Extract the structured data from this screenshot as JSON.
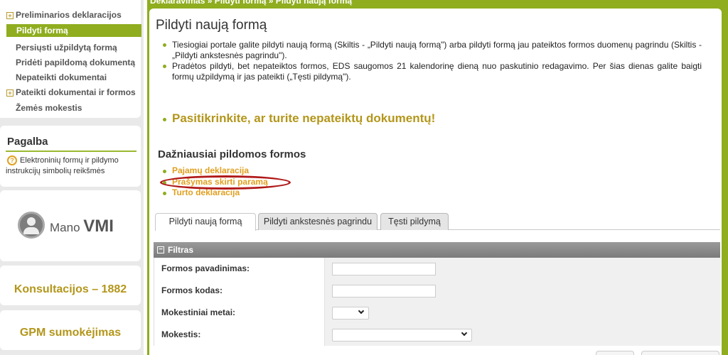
{
  "breadcrumb": "Deklaravimas » Pildyti formą » Pildyti naują formą",
  "sidebar": {
    "items": [
      {
        "label": "Preliminarios deklaracijos",
        "expandable": true
      },
      {
        "label": "Pildyti formą",
        "active": true
      },
      {
        "label": "Persiųsti užpildytą formą"
      },
      {
        "label": "Pridėti papildomą dokumentą"
      },
      {
        "label": "Nepateikti dokumentai"
      },
      {
        "label": "Pateikti dokumentai ir formos",
        "expandable": true
      },
      {
        "label": "Žemės mokestis"
      }
    ],
    "expand_glyph": "+",
    "help": {
      "title": "Pagalba",
      "icon_glyph": "?",
      "link": "Elektroninių formų ir pildymo instrukcijų simbolių reikšmės"
    },
    "logo": {
      "prefix": "Mano",
      "name": "VMI"
    },
    "promos": [
      "Konsultacijos – 1882",
      "GPM sumokėjimas"
    ]
  },
  "main": {
    "title": "Pildyti naują formą",
    "bullets": [
      "Tiesiogiai portale galite pildyti naują formą (Skiltis - „Pildyti naują formą\") arba pildyti formą jau pateiktos formos duomenų pagrindu (Skiltis - „Pildyti ankstesnės pagrindu\").",
      "Pradėtos pildyti, bet nepateiktos formos, EDS saugomos 21 kalendorinę dieną nuo paskutinio redagavimo. Per šias dienas galite baigti formų užpildymą ir jas pateikti („Tęsti pildymą\")."
    ],
    "warning": "Pasitikrinkite, ar turite nepateiktų dokumentų!",
    "frequent_title": "Dažniausiai pildomos formos",
    "frequent_links": [
      "Pajamų deklaracija",
      "Prašymas skirti paramą",
      "Turto deklaracija"
    ],
    "tabs": [
      "Pildyti naują formą",
      "Pildyti ankstesnės pagrindu",
      "Tęsti pildymą"
    ],
    "active_tab": 0
  },
  "filter": {
    "title": "Filtras",
    "collapse_glyph": "−",
    "rows": [
      {
        "label": "Formos pavadinimas:",
        "type": "text",
        "value": ""
      },
      {
        "label": "Formos kodas:",
        "type": "text",
        "value": ""
      },
      {
        "label": "Mokestiniai metai:",
        "type": "select",
        "value": ""
      },
      {
        "label": "Mokestis:",
        "type": "select",
        "value": ""
      }
    ]
  },
  "colors": {
    "accent": "#8fad1f",
    "gold": "#b3961a",
    "link": "#e0a020",
    "highlight": "#b01818"
  }
}
